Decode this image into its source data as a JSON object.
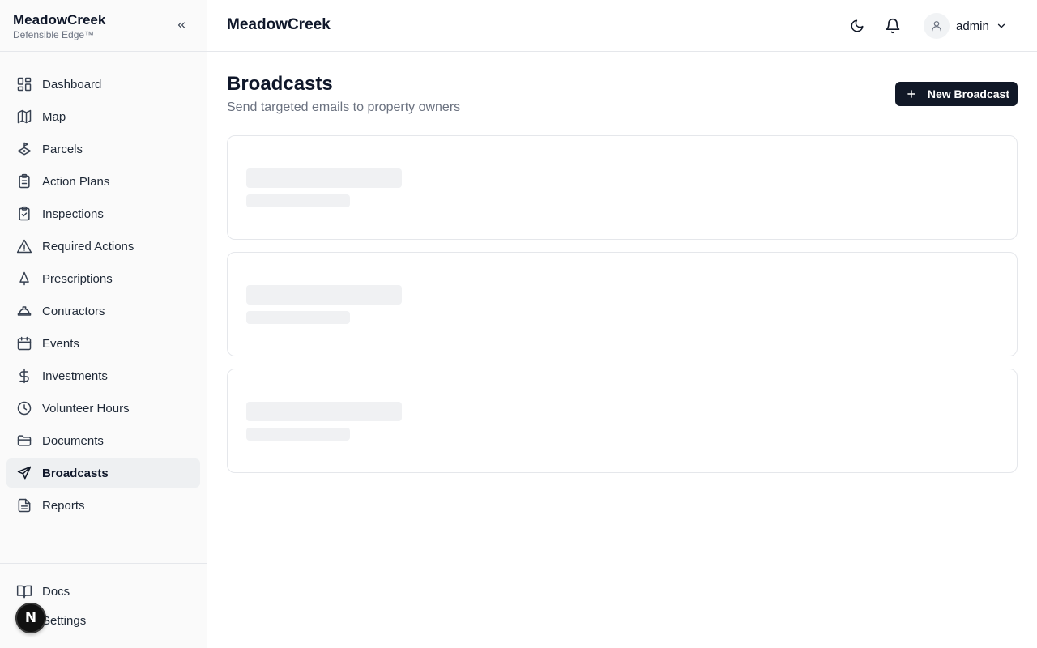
{
  "app": {
    "name": "MeadowCreek",
    "tagline": "Defensible Edge™"
  },
  "sidebar": {
    "items": [
      {
        "label": "Dashboard",
        "icon": "dashboard-icon"
      },
      {
        "label": "Map",
        "icon": "map-icon"
      },
      {
        "label": "Parcels",
        "icon": "parcels-icon"
      },
      {
        "label": "Action Plans",
        "icon": "clipboard-list-icon"
      },
      {
        "label": "Inspections",
        "icon": "clipboard-check-icon"
      },
      {
        "label": "Required Actions",
        "icon": "alert-triangle-icon"
      },
      {
        "label": "Prescriptions",
        "icon": "tree-icon"
      },
      {
        "label": "Contractors",
        "icon": "hard-hat-icon"
      },
      {
        "label": "Events",
        "icon": "calendar-icon"
      },
      {
        "label": "Investments",
        "icon": "dollar-icon"
      },
      {
        "label": "Volunteer Hours",
        "icon": "clock-icon"
      },
      {
        "label": "Documents",
        "icon": "folder-icon"
      },
      {
        "label": "Broadcasts",
        "icon": "send-icon",
        "active": true
      },
      {
        "label": "Reports",
        "icon": "file-text-icon"
      }
    ],
    "bottom": [
      {
        "label": "Docs",
        "icon": "book-icon"
      },
      {
        "label": "Settings",
        "icon": "settings-icon"
      }
    ],
    "fab_letter": "N"
  },
  "topbar": {
    "title": "MeadowCreek",
    "user": "admin"
  },
  "page": {
    "title": "Broadcasts",
    "subtitle": "Send targeted emails to property owners",
    "new_button": "New Broadcast"
  },
  "colors": {
    "accent": "#111827",
    "skeleton": "#f0f1f3",
    "active_bg": "#eef0f2"
  }
}
